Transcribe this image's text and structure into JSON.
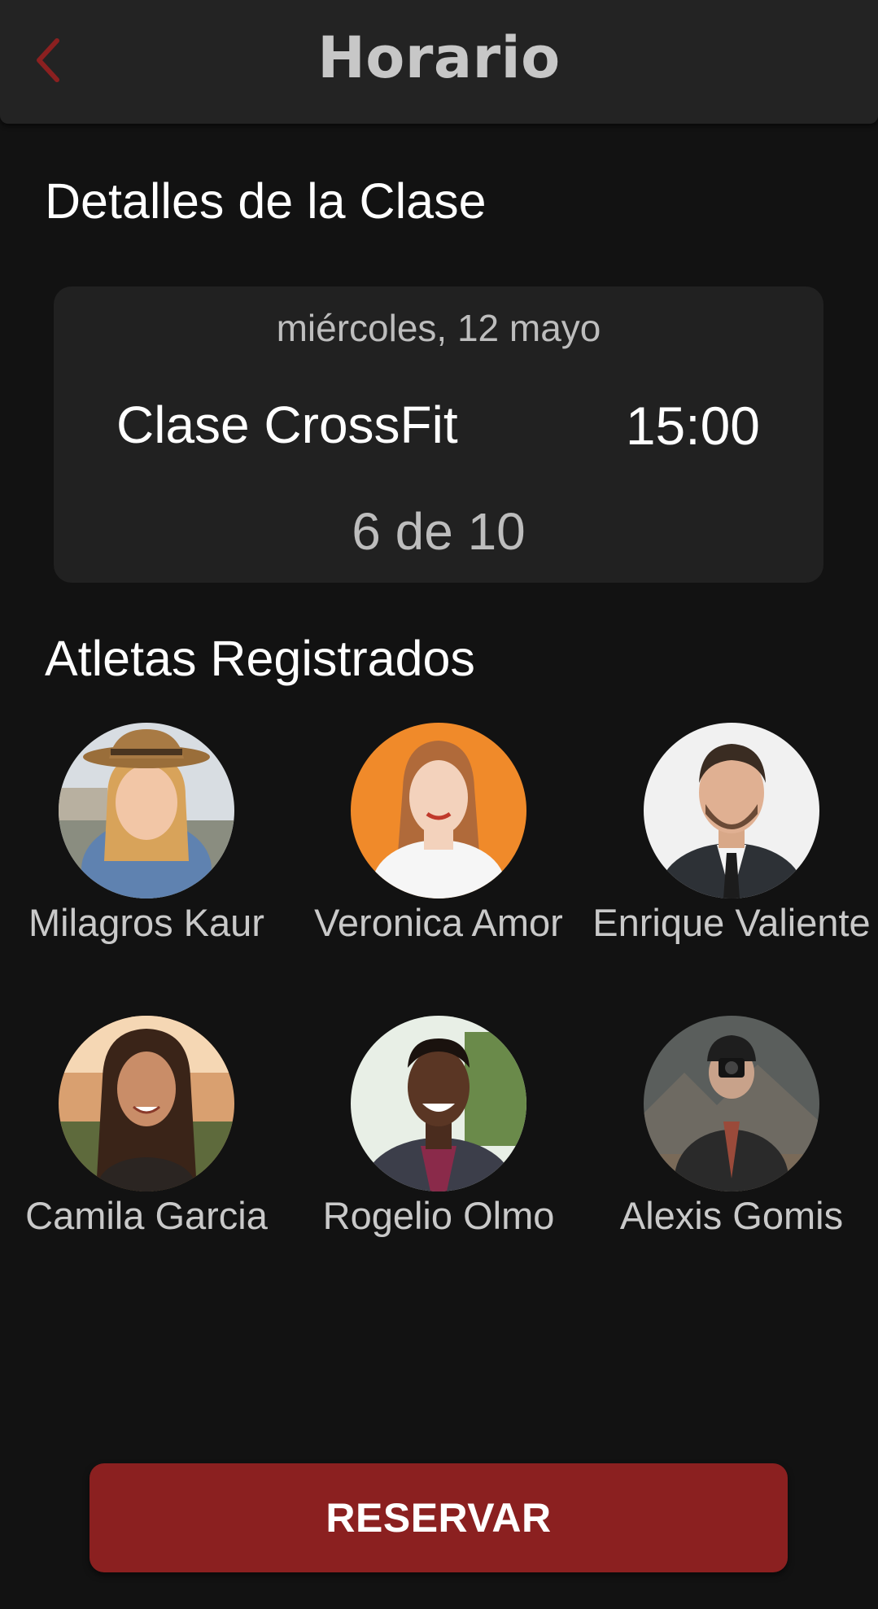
{
  "appbar": {
    "title": "Horario",
    "back_icon": "chevron-left-icon",
    "accent_color": "#8b2020"
  },
  "details": {
    "heading": "Detalles de la Clase",
    "date": "miércoles, 12 mayo",
    "class_name": "Clase CrossFit",
    "time": "15:00",
    "capacity": "6 de 10"
  },
  "athletes": {
    "heading": "Atletas Registrados",
    "items": [
      {
        "name": "Milagros Kaur"
      },
      {
        "name": "Veronica Amor"
      },
      {
        "name": "Enrique Valiente"
      },
      {
        "name": "Camila Garcia"
      },
      {
        "name": "Rogelio Olmo"
      },
      {
        "name": "Alexis Gomis"
      }
    ]
  },
  "actions": {
    "reserve_label": "RESERVAR"
  }
}
